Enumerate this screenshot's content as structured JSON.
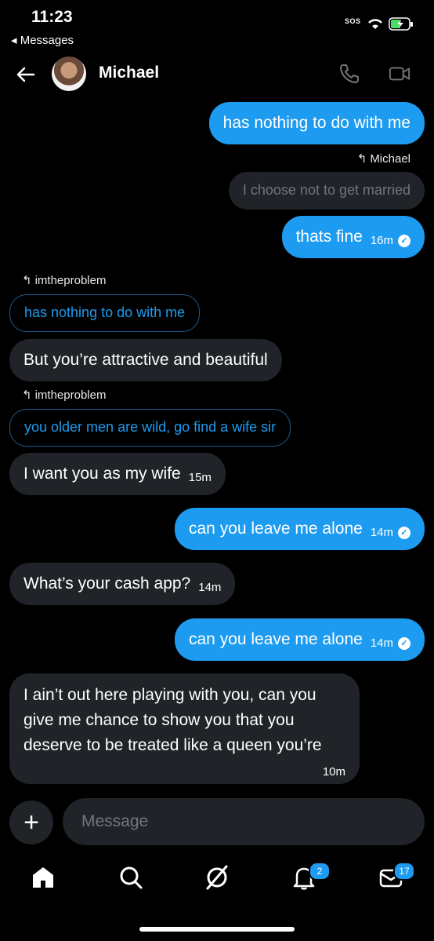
{
  "status": {
    "time": "11:23",
    "back_app": "◂ Messages",
    "sos": "SOS"
  },
  "header": {
    "name": "Michael"
  },
  "messages": [
    {
      "text": "has nothing to do with me"
    },
    {
      "reply_to": "Michael",
      "quote": "I choose not to get married"
    },
    {
      "text": "thats fine",
      "time": "16m"
    },
    {
      "reply_to": "imtheproblem",
      "quote": "has nothing to do with me",
      "text": "But you’re attractive and beautiful"
    },
    {
      "reply_to": "imtheproblem",
      "quote": "you older men are wild, go find a wife sir",
      "text": "I want you as my wife",
      "time": "15m"
    },
    {
      "text": "can you leave me alone",
      "time": "14m"
    },
    {
      "text": "What’s your cash app?",
      "time": "14m"
    },
    {
      "text": "can you leave me alone",
      "time": "14m"
    },
    {
      "lines": [
        "I ain’t out here playing with you, can you",
        "give me chance to show you that you",
        "deserve to be treated like a queen you’re"
      ],
      "time": "10m"
    }
  ],
  "composer": {
    "placeholder": "Message"
  },
  "tabs": {
    "notifications_badge": "2",
    "messages_badge": "17"
  }
}
